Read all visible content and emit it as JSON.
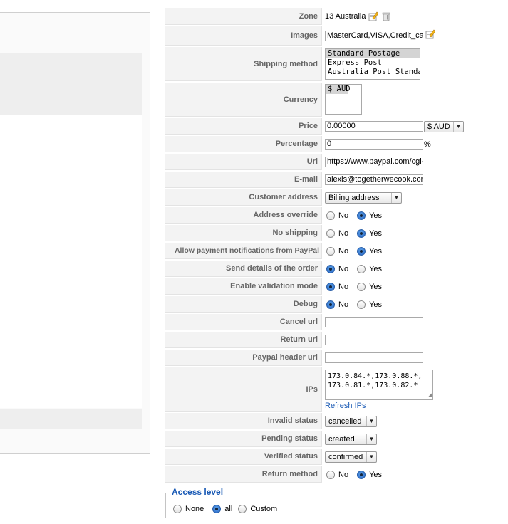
{
  "zone": {
    "label": "Zone",
    "value": "13 Australia"
  },
  "images": {
    "label": "Images",
    "value": "MasterCard,VISA,Credit_card"
  },
  "shipping_method": {
    "label": "Shipping method",
    "options": [
      "Standard Postage",
      "Express Post",
      "Australia Post Standard"
    ]
  },
  "currency": {
    "label": "Currency",
    "options": [
      "$ AUD"
    ]
  },
  "price": {
    "label": "Price",
    "value": "0.00000",
    "currency": "$ AUD"
  },
  "percentage": {
    "label": "Percentage",
    "value": "0",
    "unit": "%"
  },
  "url": {
    "label": "Url",
    "value": "https://www.paypal.com/cgi-bin/webscr"
  },
  "email": {
    "label": "E-mail",
    "value": "alexis@togetherwecook.com"
  },
  "customer_address": {
    "label": "Customer address",
    "value": "Billing address"
  },
  "radio_no": "No",
  "radio_yes": "Yes",
  "address_override": {
    "label": "Address override",
    "selected": "Yes"
  },
  "no_shipping": {
    "label": "No shipping",
    "selected": "Yes"
  },
  "allow_notifications": {
    "label": "Allow payment notifications from PayPal",
    "selected": "Yes"
  },
  "send_details": {
    "label": "Send details of the order",
    "selected": "No"
  },
  "validation_mode": {
    "label": "Enable validation mode",
    "selected": "No"
  },
  "debug": {
    "label": "Debug",
    "selected": "No"
  },
  "cancel_url": {
    "label": "Cancel url",
    "value": ""
  },
  "return_url": {
    "label": "Return url",
    "value": ""
  },
  "header_url": {
    "label": "Paypal header url",
    "value": ""
  },
  "ips": {
    "label": "IPs",
    "line1": "173.0.84.*,173.0.88.*,",
    "line2": "173.0.81.*,173.0.82.*",
    "refresh": "Refresh IPs"
  },
  "invalid_status": {
    "label": "Invalid status",
    "value": "cancelled"
  },
  "pending_status": {
    "label": "Pending status",
    "value": "created"
  },
  "verified_status": {
    "label": "Verified status",
    "value": "confirmed"
  },
  "return_method": {
    "label": "Return method",
    "selected": "Yes"
  },
  "access_level": {
    "legend": "Access level",
    "options": [
      "None",
      "all",
      "Custom"
    ],
    "selected": "all"
  },
  "colors": {
    "label_bg": "#f3f3f3",
    "link": "#1a5ab5",
    "radio_on": "#2463c5"
  }
}
